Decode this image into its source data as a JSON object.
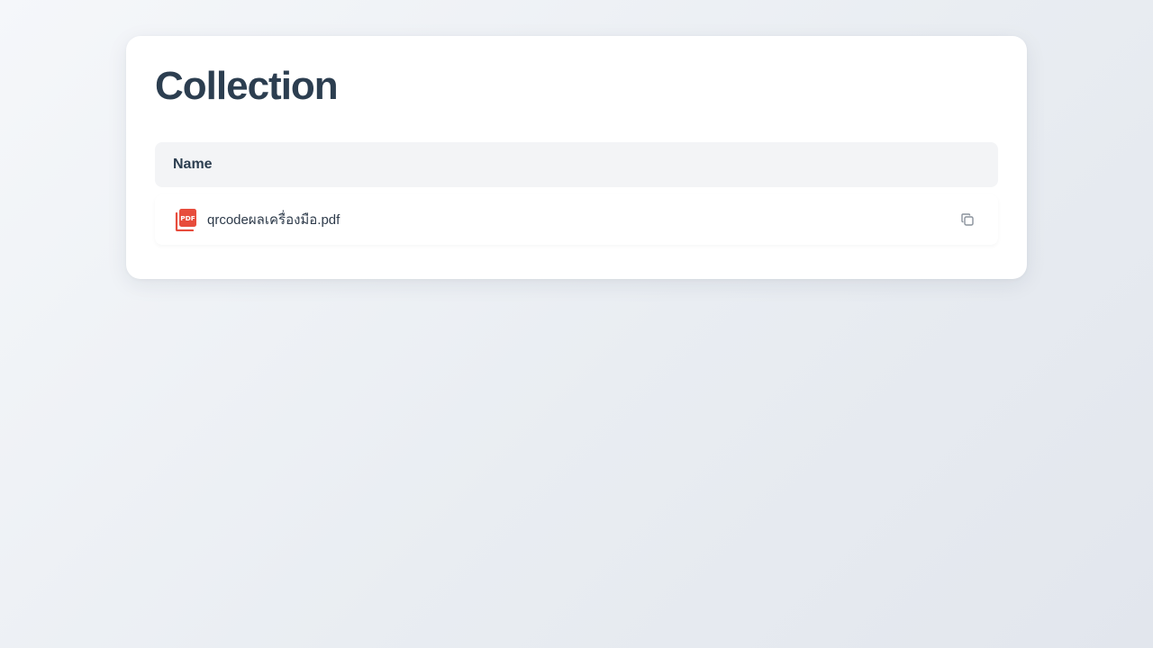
{
  "page": {
    "title": "Collection"
  },
  "table": {
    "columns": [
      "Name"
    ],
    "rows": [
      {
        "icon": "pdf-file-icon",
        "name": "qrcodeผลเครื่องมือ.pdf",
        "action_icon": "copy-icon"
      }
    ]
  },
  "colors": {
    "pdf_icon": "#e74c3c",
    "title": "#2c3e50",
    "header_bg": "#f3f4f6",
    "copy_icon": "#8a929c"
  },
  "icons": {
    "pdf_label": "PDF"
  }
}
